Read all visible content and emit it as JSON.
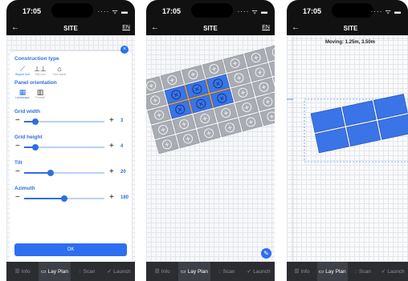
{
  "status": {
    "time": "17:05",
    "icons": "···· ᯤ ▬"
  },
  "nav": {
    "back": "←",
    "title": "SITE",
    "lang": "EN"
  },
  "tabs": [
    {
      "label": "Info",
      "icon": "☰"
    },
    {
      "label": "Lay Plan",
      "icon": "▭"
    },
    {
      "label": "Scan",
      "icon": "◌"
    },
    {
      "label": "Launch",
      "icon": "✓"
    }
  ],
  "sheet": {
    "close": "×",
    "construction_title": "Construction type",
    "construction_options": [
      "Sloped roof",
      "Flat roof",
      "Free stand"
    ],
    "orientation_title": "Panel orientation",
    "orientation_options": [
      "Landscape",
      "Portrait"
    ],
    "sliders": [
      {
        "label": "Grid width",
        "value": "3",
        "fraction": 0.14
      },
      {
        "label": "Grid height",
        "value": "4",
        "fraction": 0.14
      },
      {
        "label": "Tilt",
        "value": "20",
        "fraction": 0.33
      },
      {
        "label": "Azimuth",
        "value": "180",
        "fraction": 0.5
      }
    ],
    "ok": "OK",
    "minus": "−",
    "plus": "+"
  },
  "p2": {
    "add": "+",
    "remove": "×",
    "edit": "✎"
  },
  "p3": {
    "moving": "Moving: 1.25m, 3.50m"
  },
  "colors": {
    "accent": "#2d6ff0",
    "panel_active": "#3a74e6",
    "panel_inactive": "#a9adb3",
    "highlight": "#f39c12"
  }
}
